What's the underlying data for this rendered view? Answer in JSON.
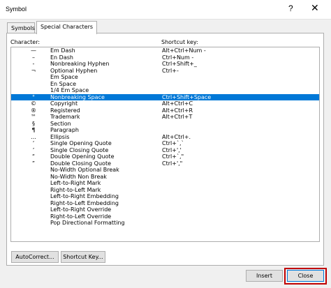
{
  "window": {
    "title": "Symbol",
    "help_glyph": "?",
    "close_glyph": "✕"
  },
  "tabs": [
    {
      "label": "Symbols",
      "active": false
    },
    {
      "label": "Special Characters",
      "active": true
    }
  ],
  "list": {
    "header_character": "Character:",
    "header_shortcut": "Shortcut key:",
    "selected_index": 7,
    "rows": [
      {
        "char": "—",
        "name": "Em Dash",
        "shortcut": "Alt+Ctrl+Num -"
      },
      {
        "char": "–",
        "name": "En Dash",
        "shortcut": "Ctrl+Num -"
      },
      {
        "char": "-",
        "name": "Nonbreaking Hyphen",
        "shortcut": "Ctrl+Shift+_"
      },
      {
        "char": "¬",
        "name": "Optional Hyphen",
        "shortcut": "Ctrl+-"
      },
      {
        "char": "",
        "name": "Em Space",
        "shortcut": ""
      },
      {
        "char": "",
        "name": "En Space",
        "shortcut": ""
      },
      {
        "char": "",
        "name": "1/4 Em Space",
        "shortcut": ""
      },
      {
        "char": "°",
        "name": "Nonbreaking Space",
        "shortcut": "Ctrl+Shift+Space"
      },
      {
        "char": "©",
        "name": "Copyright",
        "shortcut": "Alt+Ctrl+C"
      },
      {
        "char": "®",
        "name": "Registered",
        "shortcut": "Alt+Ctrl+R"
      },
      {
        "char": "™",
        "name": "Trademark",
        "shortcut": "Alt+Ctrl+T"
      },
      {
        "char": "§",
        "name": "Section",
        "shortcut": ""
      },
      {
        "char": "¶",
        "name": "Paragraph",
        "shortcut": ""
      },
      {
        "char": "…",
        "name": "Ellipsis",
        "shortcut": "Alt+Ctrl+."
      },
      {
        "char": "‘",
        "name": "Single Opening Quote",
        "shortcut": "Ctrl+`,`"
      },
      {
        "char": "’",
        "name": "Single Closing Quote",
        "shortcut": "Ctrl+','"
      },
      {
        "char": "“",
        "name": "Double Opening Quote",
        "shortcut": "Ctrl+`,\""
      },
      {
        "char": "”",
        "name": "Double Closing Quote",
        "shortcut": "Ctrl+',\""
      },
      {
        "char": "",
        "name": "No-Width Optional Break",
        "shortcut": ""
      },
      {
        "char": "",
        "name": "No-Width Non Break",
        "shortcut": ""
      },
      {
        "char": "",
        "name": "Left-to-Right Mark",
        "shortcut": ""
      },
      {
        "char": "",
        "name": "Right-to-Left Mark",
        "shortcut": ""
      },
      {
        "char": "",
        "name": "Left-to-Right Embedding",
        "shortcut": ""
      },
      {
        "char": "",
        "name": "Right-to-Left Embedding",
        "shortcut": ""
      },
      {
        "char": "",
        "name": "Left-to-Right Override",
        "shortcut": ""
      },
      {
        "char": "",
        "name": "Right-to-Left Override",
        "shortcut": ""
      },
      {
        "char": "",
        "name": "Pop Directional Formatting",
        "shortcut": ""
      }
    ]
  },
  "buttons": {
    "autocorrect": "AutoCorrect...",
    "shortcut_key": "Shortcut Key...",
    "insert": "Insert",
    "close": "Close"
  },
  "colors": {
    "selection": "#0078d7",
    "highlight_box": "#c00000"
  }
}
